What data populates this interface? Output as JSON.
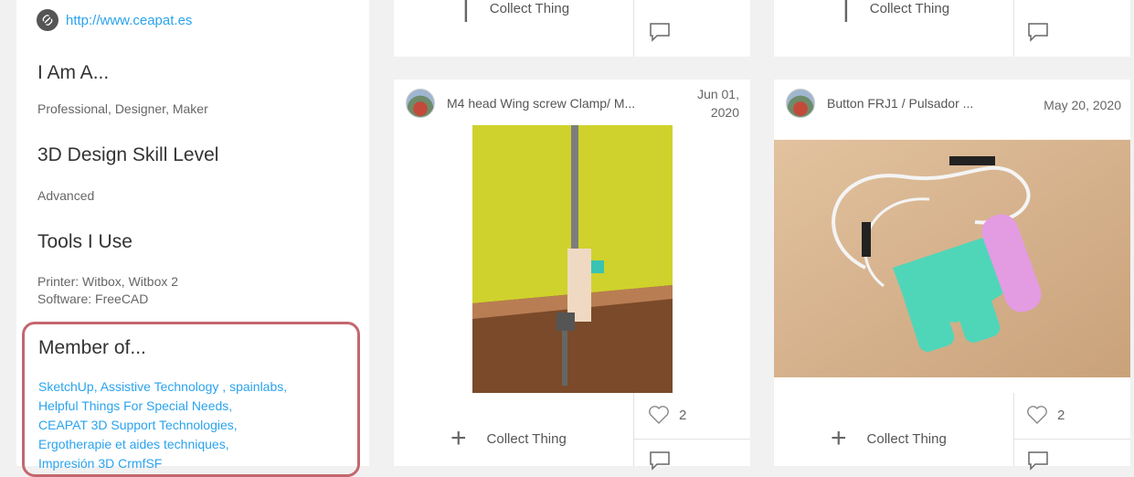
{
  "sidebar": {
    "website": "http://www.ceapat.es",
    "iam_heading": "I Am A...",
    "iam_value": "Professional, Designer, Maker",
    "skill_heading": "3D Design Skill Level",
    "skill_value": "Advanced",
    "tools_heading": "Tools I Use",
    "tools_printer": "Printer: Witbox, Witbox 2",
    "tools_software": "Software: FreeCAD",
    "member_heading": "Member of...",
    "groups": [
      "SketchUp,",
      "Assistive Technology ,",
      "spainlabs,",
      "Helpful Things For Special Needs,",
      "CEAPAT 3D Support Technologies,",
      "Ergotherapie et aides techniques,",
      "Impresión 3D CrmfSF"
    ],
    "highlight_color": "#c4676f",
    "link_color": "#2aa3ee"
  },
  "top_cards": [
    {
      "collect_label": "Collect Thing"
    },
    {
      "collect_label": "Collect Thing"
    }
  ],
  "cards": [
    {
      "title": "M4 head Wing screw Clamp/ M...",
      "date_line1": "Jun 01,",
      "date_line2": "2020",
      "likes": "2",
      "collect_label": "Collect Thing"
    },
    {
      "title": "Button FRJ1 / Pulsador ...",
      "date_line1": "May 20, 2020",
      "likes": "2",
      "collect_label": "Collect Thing"
    }
  ]
}
